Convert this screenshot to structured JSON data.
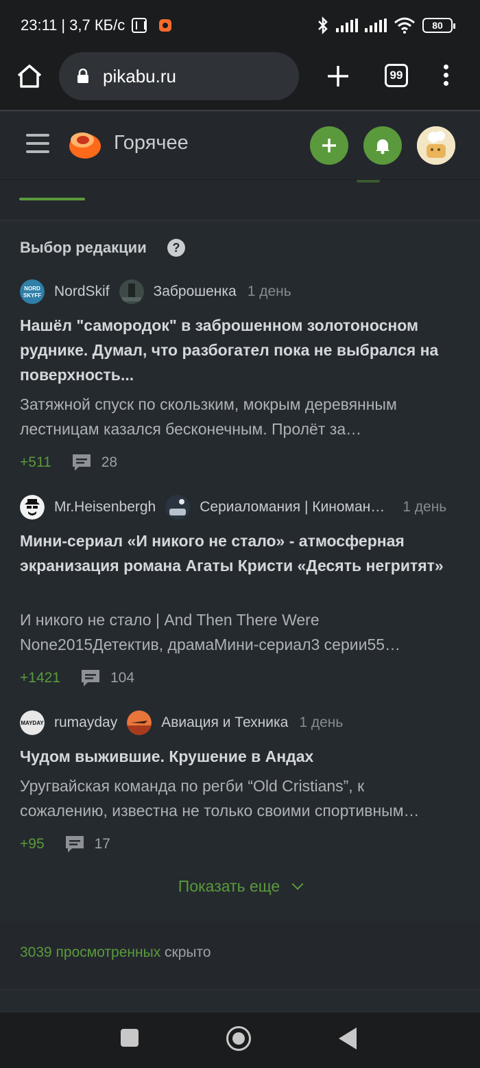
{
  "status_bar": {
    "time": "23:11",
    "speed": "3,7 КБ/с",
    "battery": "80",
    "icons": [
      "nfc-icon",
      "notification-icon",
      "bluetooth-icon",
      "signal-icon",
      "signal-icon",
      "wifi-icon",
      "battery-icon"
    ]
  },
  "browser": {
    "url": "pikabu.ru",
    "tabs_count": "99"
  },
  "header": {
    "title": "Горячее",
    "accent_color": "#5a9a3c"
  },
  "editors_choice": {
    "title": "Выбор редакции",
    "help": "?",
    "posts": [
      {
        "author": "NordSkif",
        "avatar_text": "NORD SKIFF",
        "community": "Заброшенка",
        "time": "1 день",
        "title": "Нашёл \"самородок\" в заброшенном золотоносном руднике. Думал, что разбогател пока не выбрался на поверхность...",
        "excerpt_lines": [
          "Затяжной спуск по скользким, мокрым деревянным",
          "лестницам казался бесконечным. Пролёт за…"
        ],
        "rating": "+511",
        "comments": "28"
      },
      {
        "author": "Mr.Heisenbergh",
        "avatar_text": "",
        "community": "Сериаломания | Киноман…",
        "time": "1 день",
        "title": "Мини-сериал «И никого не стало» - атмосферная экранизация романа Агаты Кристи «Десять негритят»",
        "excerpt_lines": [
          "И никого не стало | And Then There Were",
          "None2015Детектив, драмаМини-сериал3 серии55…"
        ],
        "rating": "+1421",
        "comments": "104"
      },
      {
        "author": "rumayday",
        "avatar_text": "MAYDAY",
        "community": "Авиация и Техника",
        "time": "1 день",
        "title": "Чудом выжившие. Крушение в Андах",
        "excerpt_lines": [
          "Уругвайская команда по регби “Old Cristians”, к",
          "сожалению, известна не только своими спортивным…"
        ],
        "rating": "+95",
        "comments": "17"
      }
    ],
    "show_more": "Показать еще"
  },
  "viewed": {
    "count_label": "3039 просмотренных",
    "hidden_label": " скрыто"
  }
}
